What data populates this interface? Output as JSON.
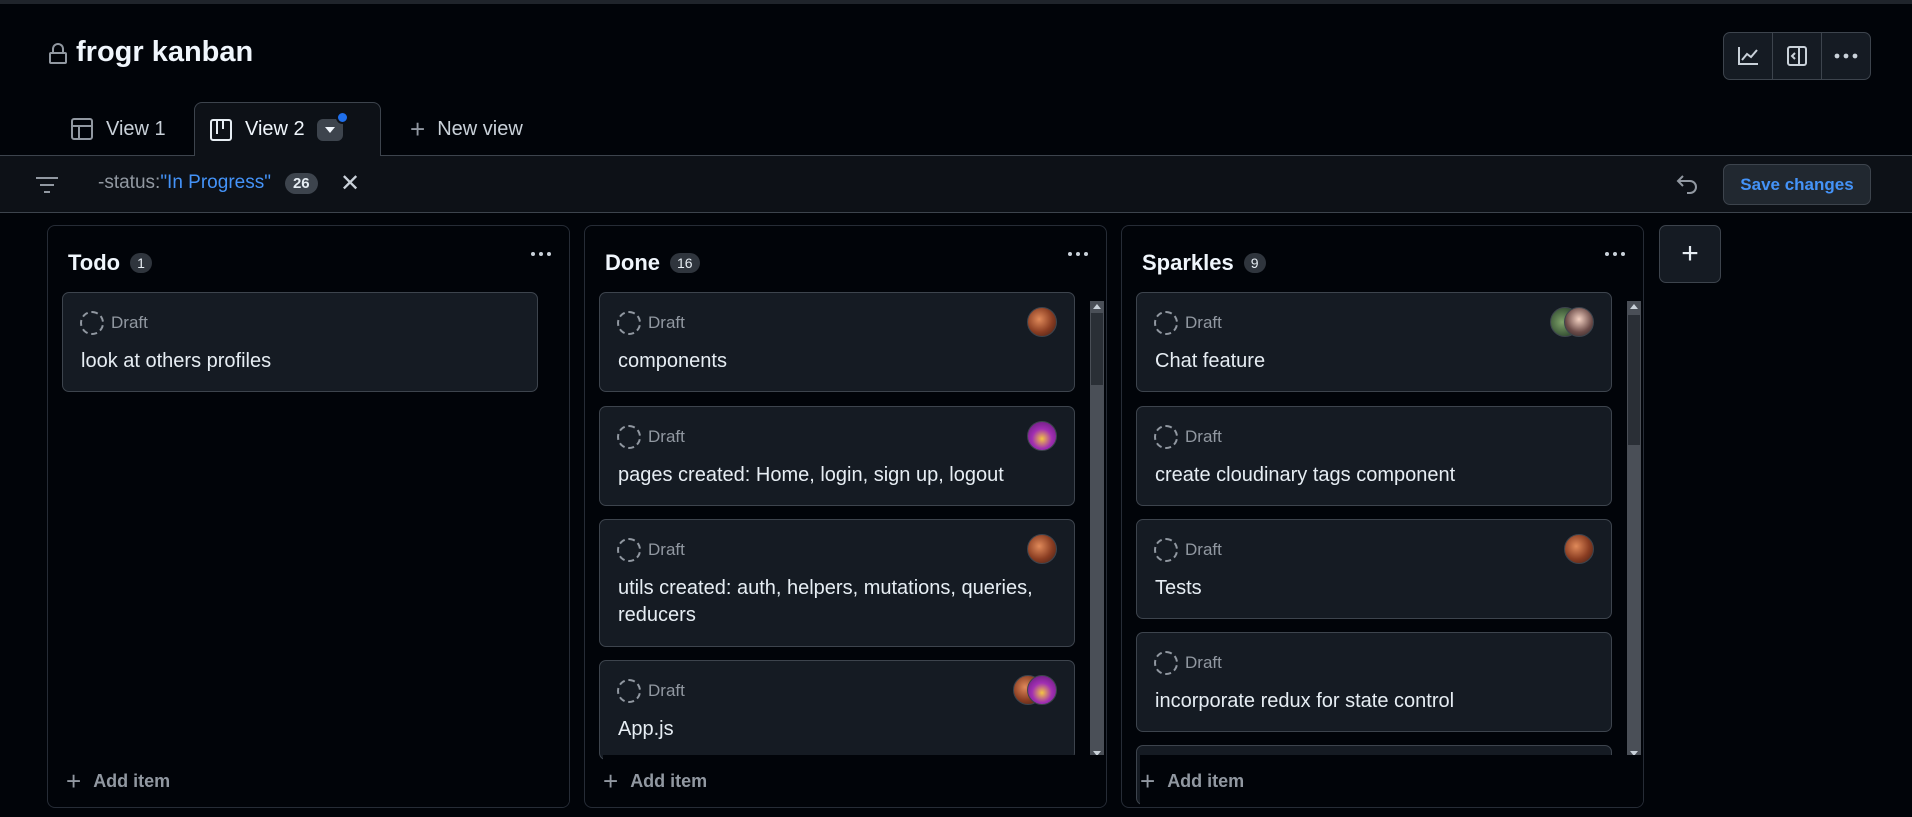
{
  "project": {
    "title": "frogr kanban"
  },
  "header": {
    "buttons": [
      {
        "icon": "graph-icon"
      },
      {
        "icon": "sidebar-panel-icon"
      },
      {
        "icon": "kebab-horizontal-icon"
      }
    ]
  },
  "tabs": [
    {
      "label": "View 1",
      "icon": "table-icon",
      "active": false
    },
    {
      "label": "View 2",
      "icon": "board-icon",
      "active": true
    },
    {
      "label": "New view",
      "icon": "plus-icon",
      "active": false
    }
  ],
  "filter": {
    "prefix": "-status:",
    "value": "\"In Progress\"",
    "count": "26",
    "save_label": "Save changes"
  },
  "columns": [
    {
      "title": "Todo",
      "count": "1",
      "add_label": "Add item",
      "cards": [
        {
          "status": "Draft",
          "title": "look at others profiles"
        }
      ]
    },
    {
      "title": "Done",
      "count": "16",
      "add_label": "Add item",
      "cards": [
        {
          "status": "Draft",
          "title": "components"
        },
        {
          "status": "Draft",
          "title": "pages created: Home, login, sign up, logout"
        },
        {
          "status": "Draft",
          "title": "utils created: auth, helpers, mutations, queries, reducers"
        },
        {
          "status": "Draft",
          "title": "App.js"
        }
      ]
    },
    {
      "title": "Sparkles",
      "count": "9",
      "add_label": "Add item",
      "cards": [
        {
          "status": "Draft",
          "title": "Chat feature"
        },
        {
          "status": "Draft",
          "title": "create cloudinary tags component"
        },
        {
          "status": "Draft",
          "title": "Tests"
        },
        {
          "status": "Draft",
          "title": "incorporate redux for state control"
        }
      ]
    }
  ],
  "add_column": {
    "label": "+"
  },
  "colors": {
    "background": "#010409",
    "card": "#151b23",
    "border": "#3d444d",
    "accent_link": "#4493f8",
    "indicator": "#1f6feb"
  }
}
